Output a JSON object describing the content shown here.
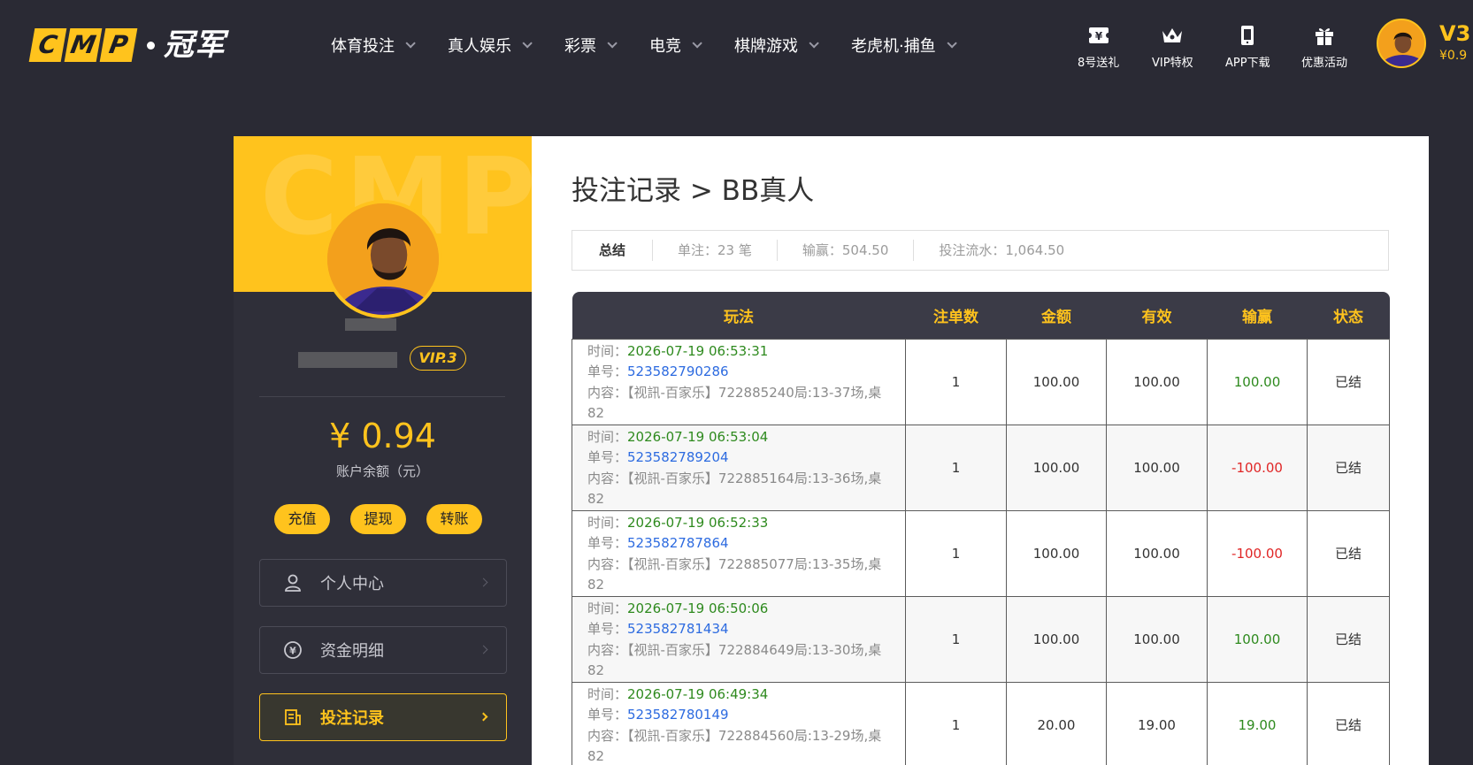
{
  "header": {
    "logo_letters": [
      "C",
      "M",
      "P"
    ],
    "logo_cn": "冠军",
    "nav": [
      {
        "label": "体育投注"
      },
      {
        "label": "真人娱乐"
      },
      {
        "label": "彩票"
      },
      {
        "label": "电竞"
      },
      {
        "label": "棋牌游戏"
      },
      {
        "label": "老虎机·捕鱼"
      }
    ],
    "quick_links": [
      {
        "label": "8号送礼",
        "icon": "ticket-icon"
      },
      {
        "label": "VIP特权",
        "icon": "crown-icon"
      },
      {
        "label": "APP下载",
        "icon": "phone-icon"
      },
      {
        "label": "优惠活动",
        "icon": "gift-icon"
      }
    ],
    "vip_level": "V3",
    "balance": "¥0.9"
  },
  "sidebar": {
    "watermark": "CMP",
    "vip_badge": "VIP.3",
    "balance": "¥ 0.94",
    "balance_label": "账户余额（元）",
    "actions": [
      "充值",
      "提现",
      "转账"
    ],
    "menu": [
      {
        "label": "个人中心",
        "icon": "user-icon",
        "active": false
      },
      {
        "label": "资金明细",
        "icon": "yen-circle-icon",
        "active": false
      },
      {
        "label": "投注记录",
        "icon": "receipt-icon",
        "active": true
      }
    ]
  },
  "main": {
    "title": "投注记录 > BB真人",
    "summary": {
      "label": "总结",
      "count": "单注：23 笔",
      "profit": "输赢：504.50",
      "turnover": "投注流水：1,064.50"
    },
    "columns": [
      "玩法",
      "注单数",
      "金额",
      "有效",
      "输赢",
      "状态"
    ],
    "row_labels": {
      "time": "时间：",
      "order": "单号：",
      "content": "内容："
    },
    "rows": [
      {
        "time": "2026-07-19 06:53:31",
        "order": "523582790286",
        "content": "【视訊-百家乐】722885240局:13-37场,桌82",
        "count": "1",
        "amount": "100.00",
        "valid": "100.00",
        "result": "100.00",
        "result_type": "win",
        "status": "已结"
      },
      {
        "time": "2026-07-19 06:53:04",
        "order": "523582789204",
        "content": "【视訊-百家乐】722885164局:13-36场,桌82",
        "count": "1",
        "amount": "100.00",
        "valid": "100.00",
        "result": "-100.00",
        "result_type": "lose",
        "status": "已结"
      },
      {
        "time": "2026-07-19 06:52:33",
        "order": "523582787864",
        "content": "【视訊-百家乐】722885077局:13-35场,桌82",
        "count": "1",
        "amount": "100.00",
        "valid": "100.00",
        "result": "-100.00",
        "result_type": "lose",
        "status": "已结"
      },
      {
        "time": "2026-07-19 06:50:06",
        "order": "523582781434",
        "content": "【视訊-百家乐】722884649局:13-30场,桌82",
        "count": "1",
        "amount": "100.00",
        "valid": "100.00",
        "result": "100.00",
        "result_type": "win",
        "status": "已结"
      },
      {
        "time": "2026-07-19 06:49:34",
        "order": "523582780149",
        "content": "【视訊-百家乐】722884560局:13-29场,桌82",
        "count": "1",
        "amount": "20.00",
        "valid": "19.00",
        "result": "19.00",
        "result_type": "win",
        "status": "已结"
      }
    ]
  },
  "colors": {
    "accent": "#ffc31d",
    "background": "#2a2a34",
    "win": "#2e8a1e",
    "lose": "#e02626",
    "link": "#2d6be0"
  }
}
